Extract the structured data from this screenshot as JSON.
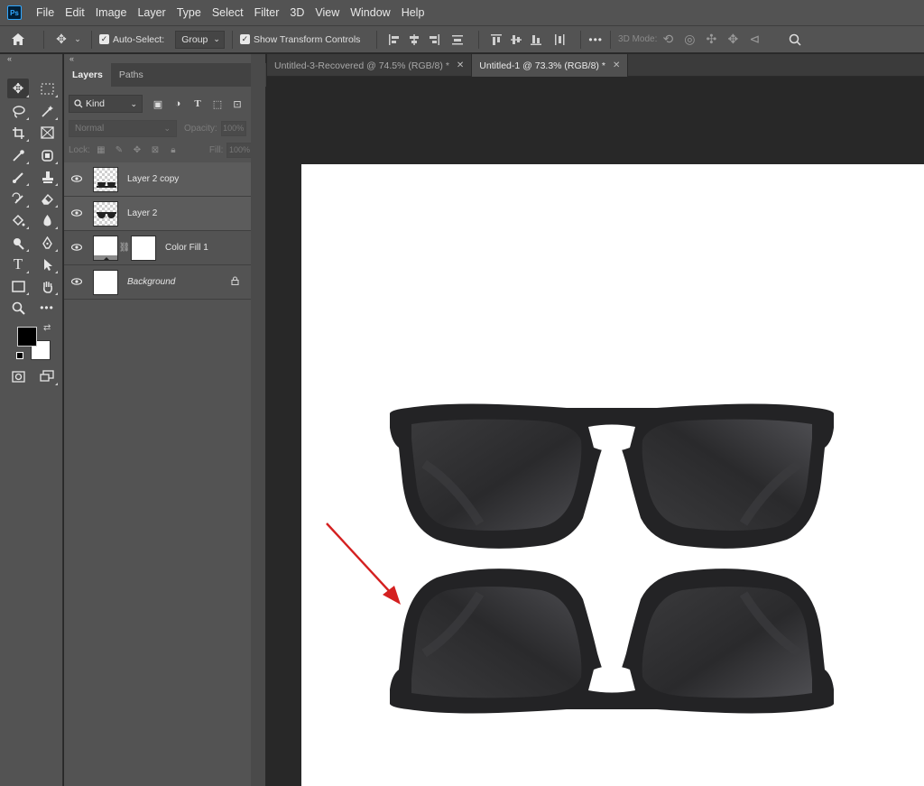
{
  "app": {
    "logo_text": "Ps"
  },
  "menu": {
    "items": [
      "File",
      "Edit",
      "Image",
      "Layer",
      "Type",
      "Select",
      "Filter",
      "3D",
      "View",
      "Window",
      "Help"
    ]
  },
  "options_bar": {
    "auto_select_label": "Auto-Select:",
    "auto_select_value": "Group",
    "transform_label": "Show Transform Controls",
    "mode_3d_label": "3D Mode:",
    "more_label": "•••"
  },
  "panel": {
    "tabs": [
      "Layers",
      "Paths"
    ],
    "filter_kind": "Kind",
    "blend_mode": "Normal",
    "opacity_label": "Opacity:",
    "opacity_value": "100%",
    "lock_label": "Lock:",
    "fill_label": "Fill:",
    "fill_value": "100%"
  },
  "layers": [
    {
      "name": "Layer 2 copy",
      "selected": true,
      "thumb": "checker-flipped"
    },
    {
      "name": "Layer 2",
      "selected": true,
      "thumb": "checker"
    },
    {
      "name": "Color Fill 1",
      "selected": false,
      "thumb": "fill"
    },
    {
      "name": "Background",
      "selected": false,
      "thumb": "white",
      "locked": true
    }
  ],
  "documents": [
    {
      "title": "Untitled-3-Recovered @ 74.5% (RGB/8) *",
      "active": false
    },
    {
      "title": "Untitled-1 @ 73.3% (RGB/8) *",
      "active": true
    }
  ],
  "colors": {
    "foreground": "#000000",
    "background": "#ffffff",
    "annotation_arrow": "#d42020"
  }
}
